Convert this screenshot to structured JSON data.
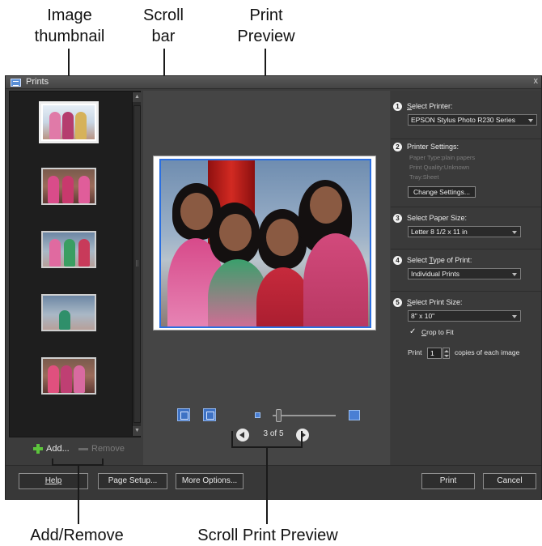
{
  "callouts": {
    "image_thumbnail": "Image\nthumbnail",
    "scroll_bar": "Scroll\nbar",
    "print_preview": "Print\nPreview",
    "add_remove": "Add/Remove",
    "scroll_print_preview": "Scroll Print Preview"
  },
  "window": {
    "title": "Prints",
    "close_glyph": "x"
  },
  "thumbnails": {
    "count": 5,
    "selected_index": 0
  },
  "thumb_actions": {
    "add_label": "Add...",
    "remove_label": "Remove"
  },
  "preview": {
    "page_indicator": "3 of 5",
    "zoom_level": 0.05
  },
  "settings": {
    "step1": {
      "num": "1",
      "title": "Select Printer:",
      "value": "EPSON Stylus Photo R230 Series"
    },
    "step2": {
      "num": "2",
      "title": "Printer Settings:",
      "paper_type": "Paper Type:plain papers",
      "print_quality": "Print Quality:Unknown",
      "tray": "Tray:Sheet",
      "change_button": "Change Settings..."
    },
    "step3": {
      "num": "3",
      "title": "Select Paper Size:",
      "value": "Letter 8 1/2 x 11 in"
    },
    "step4": {
      "num": "4",
      "title": "Select Type of Print:",
      "value": "Individual Prints"
    },
    "step5": {
      "num": "5",
      "title": "Select Print Size:",
      "value": "8\" x 10\"",
      "crop_label": "Crop to Fit",
      "crop_checked": "✓",
      "print_prefix": "Print",
      "copies": "1",
      "copies_suffix": "copies of each image"
    }
  },
  "bottom_bar": {
    "help": "Help",
    "page_setup": "Page Setup...",
    "more_options": "More Options...",
    "print": "Print",
    "cancel": "Cancel"
  },
  "colors": {
    "accent_blue": "#2b6fe0",
    "add_green": "#5cc43c",
    "panel_dark": "#1e1e1e",
    "chrome": "#3c3c3c"
  }
}
